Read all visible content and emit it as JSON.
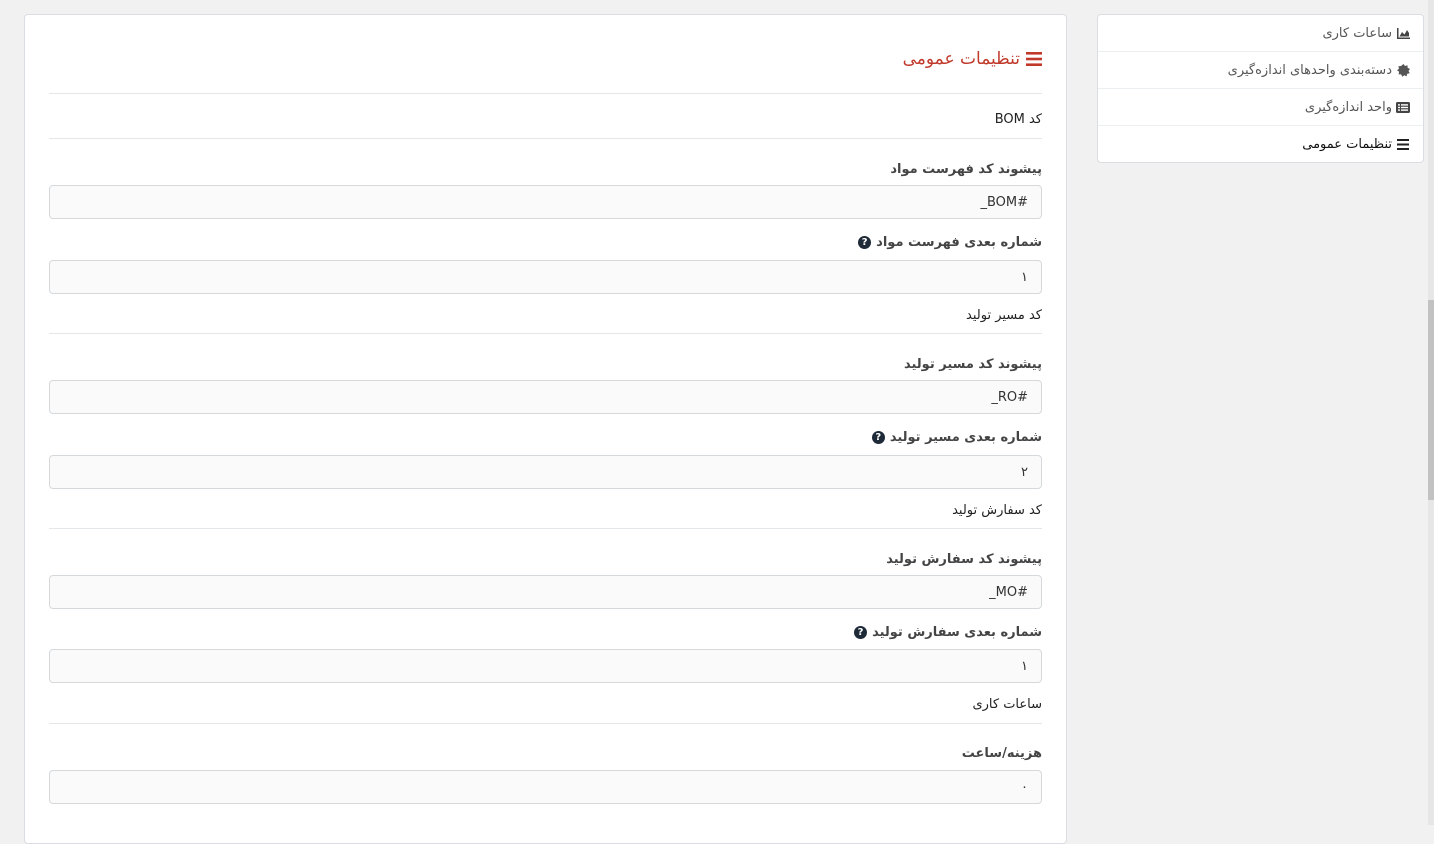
{
  "sidebar": {
    "items": [
      {
        "label": "ساعات کاری",
        "icon": "chart-area-icon"
      },
      {
        "label": "دسته‌بندی واحدهای اندازه‌گیری",
        "icon": "gear-badge-icon"
      },
      {
        "label": "واحد اندازه‌گیری",
        "icon": "list-box-icon"
      },
      {
        "label": "تنظیمات عمومی",
        "icon": "menu-lines-icon"
      }
    ]
  },
  "page": {
    "title": "تنظیمات عمومی",
    "title_icon": "menu-lines-icon",
    "accent_color": "#c0392b"
  },
  "sections": {
    "bom": "کد BOM",
    "routing": "کد مسیر تولید",
    "mo": "کد سفارش تولید",
    "hours": "ساعات کاری"
  },
  "fields": {
    "bom_prefix": {
      "label": "پیشوند کد فهرست مواد",
      "value": "#BOM_"
    },
    "bom_next": {
      "label": "شماره بعدی فهرست مواد",
      "value": "۱"
    },
    "ro_prefix": {
      "label": "پیشوند کد مسیر تولید",
      "value": "#RO_"
    },
    "ro_next": {
      "label": "شماره بعدی مسیر تولید",
      "value": "۲"
    },
    "mo_prefix": {
      "label": "پیشوند کد سفارش تولید",
      "value": "#MO_"
    },
    "mo_next": {
      "label": "شماره بعدی سفارش تولید",
      "value": "۱"
    },
    "cost_hour": {
      "label": "هزینه/ساعت",
      "value": "۰"
    }
  }
}
